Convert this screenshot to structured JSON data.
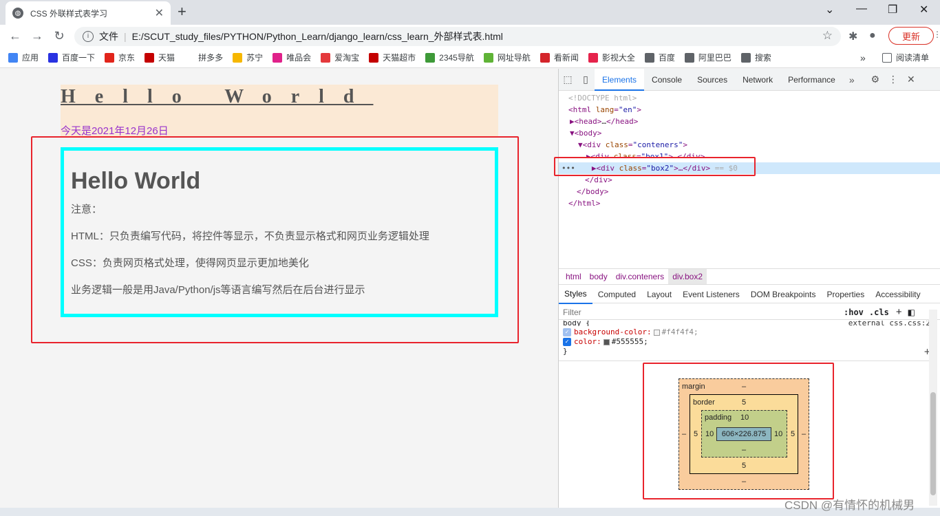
{
  "browser": {
    "tab_title": "CSS 外联样式表学习",
    "address_prefix": "文件",
    "address_url": "E:/SCUT_study_files/PYTHON/Python_Learn/django_learn/css_learn_外部样式表.html",
    "update_button": "更新"
  },
  "bookmarks": [
    {
      "label": "应用",
      "icon": "apps-icon",
      "color": "#4285f4"
    },
    {
      "label": "百度一下",
      "icon": "baidu-icon",
      "color": "#2932e1"
    },
    {
      "label": "京东",
      "icon": "jd-icon",
      "color": "#e1251b"
    },
    {
      "label": "天猫",
      "icon": "tmall-icon",
      "color": "#c40000"
    },
    {
      "label": "拼多多",
      "icon": "pinduoduo-icon",
      "color": "#ffffff"
    },
    {
      "label": "苏宁",
      "icon": "suning-icon",
      "color": "#f6b700"
    },
    {
      "label": "唯品会",
      "icon": "vip-icon",
      "color": "#e0218a"
    },
    {
      "label": "爱淘宝",
      "icon": "taobao-icon",
      "color": "#e4393c"
    },
    {
      "label": "天猫超市",
      "icon": "tmall-market-icon",
      "color": "#c40000"
    },
    {
      "label": "2345导航",
      "icon": "2345-icon",
      "color": "#3e9a38"
    },
    {
      "label": "网址导航",
      "icon": "7654-icon",
      "color": "#5fb336"
    },
    {
      "label": "看新闻",
      "icon": "news-icon",
      "color": "#d4252b"
    },
    {
      "label": "影视大全",
      "icon": "video-icon",
      "color": "#e5234b"
    },
    {
      "label": "百度",
      "icon": "globe-icon",
      "color": "#5f6368"
    },
    {
      "label": "阿里巴巴",
      "icon": "globe-icon",
      "color": "#5f6368"
    },
    {
      "label": "搜索",
      "icon": "globe-icon",
      "color": "#5f6368"
    }
  ],
  "bookmarks_more": "»",
  "reading_list": "阅读清单",
  "page": {
    "box1_heading": "Hello World",
    "box1_date": "今天是2021年12月26日",
    "box2_heading": "Hello World",
    "paragraphs": [
      "注意：",
      "HTML：只负责编写代码，将控件等显示，不负责显示格式和网页业务逻辑处理",
      "CSS：负责网页格式处理，使得网页显示更加地美化",
      "业务逻辑一般是用Java/Python/js等语言编写然后在后台进行显示"
    ]
  },
  "devtools": {
    "tabs": [
      "Elements",
      "Console",
      "Sources",
      "Network",
      "Performance"
    ],
    "active_tab": "Elements",
    "more": "»",
    "dom": {
      "doctype": "<!DOCTYPE html>",
      "html_open_tag": "html",
      "html_lang_attr": "lang",
      "html_lang_val": "\"en\"",
      "head": "head",
      "head_ellipsis": "…",
      "body": "body",
      "div_tag": "div",
      "class_attr": "class",
      "conteners_val": "\"conteners\"",
      "box1_val": "\"box1\"",
      "box2_val": "\"box2\"",
      "sel_suffix": "== $0",
      "close_div": "</div>",
      "close_body": "</body>",
      "close_html": "</html>",
      "dots": "•••"
    },
    "breadcrumbs": [
      "html",
      "body",
      "div.conteners",
      "div.box2"
    ],
    "subtabs": [
      "Styles",
      "Computed",
      "Layout",
      "Event Listeners",
      "DOM Breakpoints",
      "Properties",
      "Accessibility"
    ],
    "filter_placeholder": "Filter",
    "filter_hov": ":hov",
    "filter_cls": ".cls",
    "rule_selector": "body {",
    "rule_source": "external_css.css:2",
    "rule_props": [
      {
        "name": "background-color",
        "value": "#f4f4f4;",
        "swatch": "#f4f4f4",
        "enabled": false
      },
      {
        "name": "color",
        "value": "#555555;",
        "swatch": "#555555",
        "enabled": true
      }
    ],
    "rule_close": "}",
    "box_model": {
      "margin_label": "margin",
      "margin_top": "–",
      "margin_bottom": "–",
      "margin_left": "–",
      "margin_right": "–",
      "border_label": "border",
      "border_top": "5",
      "border_bottom": "5",
      "border_left": "5",
      "border_right": "5",
      "padding_label": "padding",
      "padding_top": "10",
      "padding_bottom": "–",
      "padding_left": "10",
      "padding_right": "10",
      "content": "606×226.875"
    }
  },
  "watermark": "CSDN @有情怀的机械男",
  "colors": {
    "highlight_red": "#e8232c",
    "box2_border": "#00ffff",
    "date_color": "#9932cc",
    "box1_bg": "#fbe9d5"
  }
}
